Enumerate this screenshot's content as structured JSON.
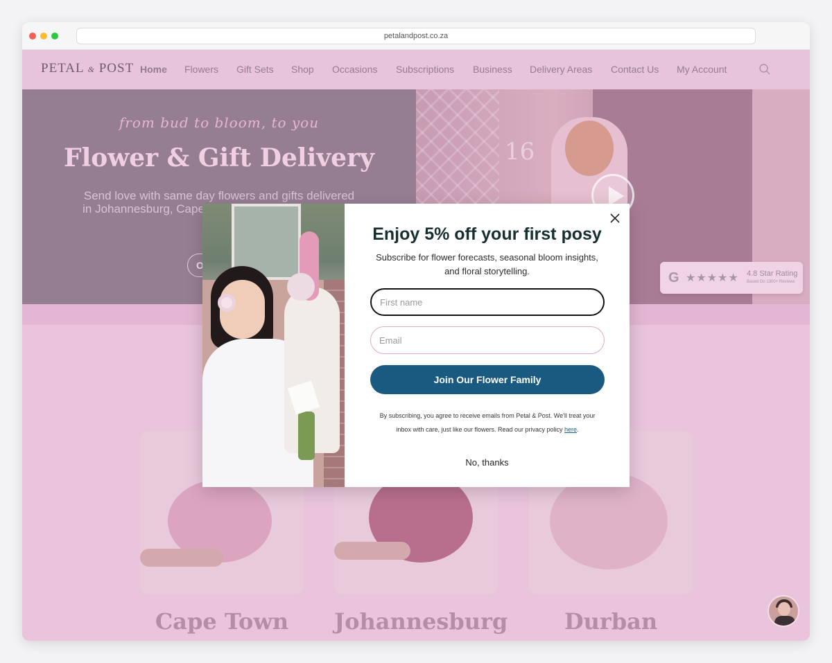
{
  "browser": {
    "url": "petalandpost.co.za"
  },
  "site": {
    "logo": {
      "part1": "PETAL",
      "amp": "&",
      "part2": "POST"
    },
    "nav": [
      {
        "label": "Home",
        "active": true
      },
      {
        "label": "Flowers"
      },
      {
        "label": "Gift Sets"
      },
      {
        "label": "Shop"
      },
      {
        "label": "Occasions"
      },
      {
        "label": "Subscriptions"
      },
      {
        "label": "Business"
      },
      {
        "label": "Delivery Areas"
      },
      {
        "label": "Contact Us"
      },
      {
        "label": "My Account"
      }
    ],
    "hero": {
      "tagline": "from bud to bloom, to you",
      "title": "Flower & Gift Delivery",
      "subtitle": "Send love with same day flowers and gifts delivered in Johannesburg, Cape Town and Durban surrounds",
      "cta_label": "Order"
    },
    "house_number": "16",
    "rating": {
      "google_glyph": "G",
      "stars": "★★★★★",
      "text": "4.8 Star Rating",
      "sub": "Based On 1300+ Reviews"
    },
    "cities": [
      "Cape Town",
      "Johannesburg",
      "Durban"
    ]
  },
  "modal": {
    "title": "Enjoy 5% off your first posy",
    "subtitle": "Subscribe for flower forecasts, seasonal bloom insights, and floral storytelling.",
    "first_name_placeholder": "First name",
    "email_placeholder": "Email",
    "join_label": "Join Our Flower Family",
    "fine_print_before": "By subscribing, you agree to receive emails from Petal & Post. We'll treat your inbox with care, just like our flowers. Read our privacy policy ",
    "fine_print_link": "here",
    "fine_print_after": ".",
    "no_thanks_label": "No, thanks"
  },
  "colors": {
    "accent": "#1b5a80",
    "site_pink": "#e9c4dc",
    "hero_mauve": "#967e92"
  }
}
